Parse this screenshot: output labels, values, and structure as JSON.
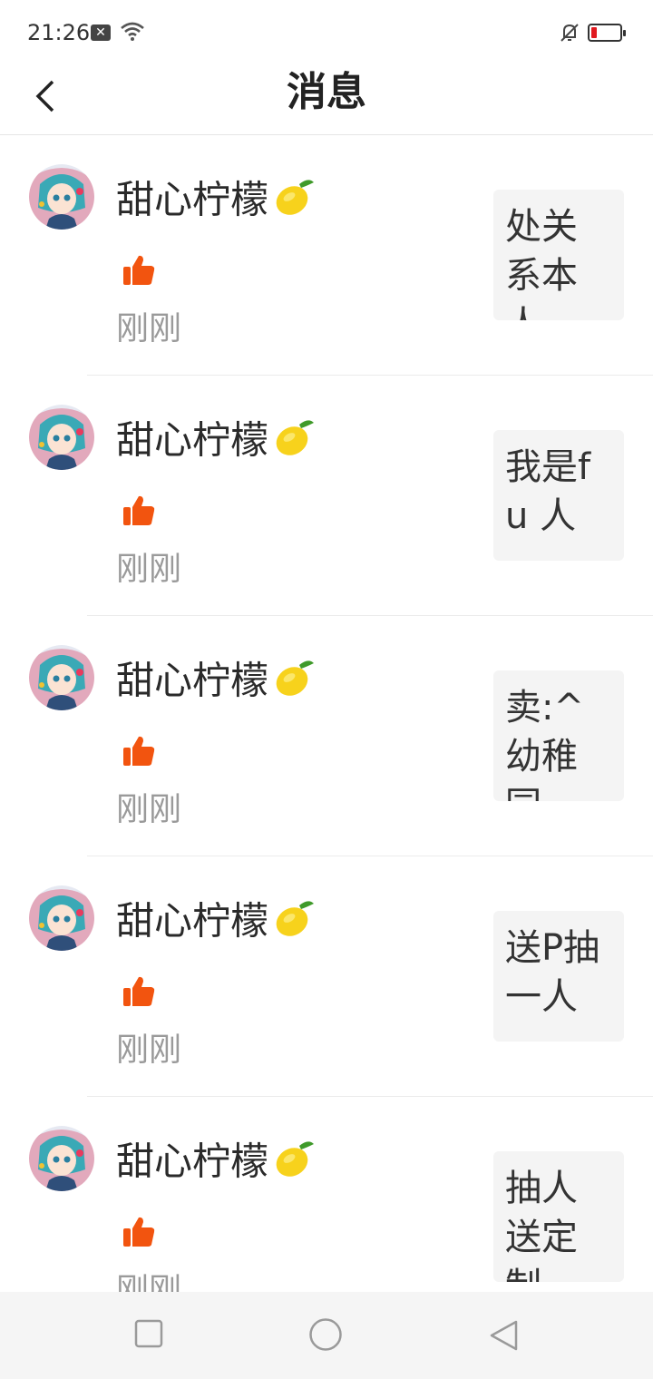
{
  "status_bar": {
    "time": "21:26",
    "icons": [
      "close-box-icon",
      "wifi-icon",
      "bell-off-icon",
      "battery-low-icon"
    ],
    "battery_color": "#e0191f"
  },
  "header": {
    "title": "消息",
    "back_icon": "chevron-left-icon"
  },
  "colors": {
    "like": "#f2540f",
    "preview_bg": "#f4f4f4",
    "time_text": "#9a9a9a"
  },
  "messages": [
    {
      "username": "甜心柠檬",
      "action_icon": "thumbs-up-icon",
      "time": "刚刚",
      "preview": "处关系本人"
    },
    {
      "username": "甜心柠檬",
      "action_icon": "thumbs-up-icon",
      "time": "刚刚",
      "preview": "我是fu 人"
    },
    {
      "username": "甜心柠檬",
      "action_icon": "thumbs-up-icon",
      "time": "刚刚",
      "preview": "卖:^幼稚园."
    },
    {
      "username": "甜心柠檬",
      "action_icon": "thumbs-up-icon",
      "time": "刚刚",
      "preview": "送P抽一人"
    },
    {
      "username": "甜心柠檬",
      "action_icon": "thumbs-up-icon",
      "time": "刚刚",
      "preview": "抽人送定制"
    }
  ],
  "nav_bar": {
    "icons": [
      "recent-apps-icon",
      "home-icon",
      "back-triangle-icon"
    ]
  }
}
